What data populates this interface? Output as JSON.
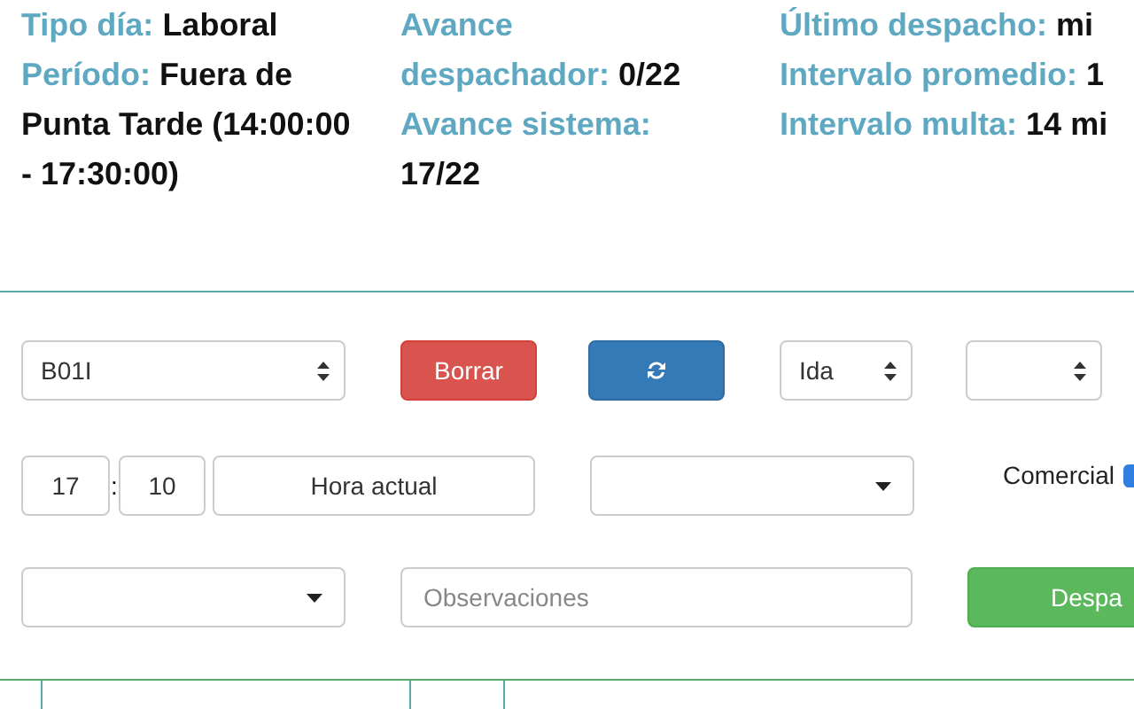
{
  "summary": {
    "columns": [
      [
        {
          "label": "Tipo día:",
          "value": "Laboral"
        },
        {
          "label": "Período:",
          "value": "Fuera de Punta Tarde (14:00:00 - 17:30:00)"
        }
      ],
      [
        {
          "label": "Avance despachador:",
          "value": "0/22"
        },
        {
          "label": "Avance sistema:",
          "value": "17/22"
        }
      ],
      [
        {
          "label": "Último despacho:",
          "value": "mi"
        },
        {
          "label": "Intervalo promedio:",
          "value": "1"
        },
        {
          "label": "Intervalo multa:",
          "value": "14 mi"
        }
      ]
    ]
  },
  "route_select": {
    "value": "B01I"
  },
  "delete_button": {
    "label": "Borrar"
  },
  "direction_select": {
    "value": "Ida"
  },
  "time": {
    "hours": "17",
    "separator": ":",
    "minutes": "10",
    "now_button": "Hora actual"
  },
  "commercial": {
    "label": "Comercial",
    "checked": true
  },
  "observations": {
    "placeholder": "Observaciones"
  },
  "dispatch_button": {
    "label": "Despa"
  }
}
